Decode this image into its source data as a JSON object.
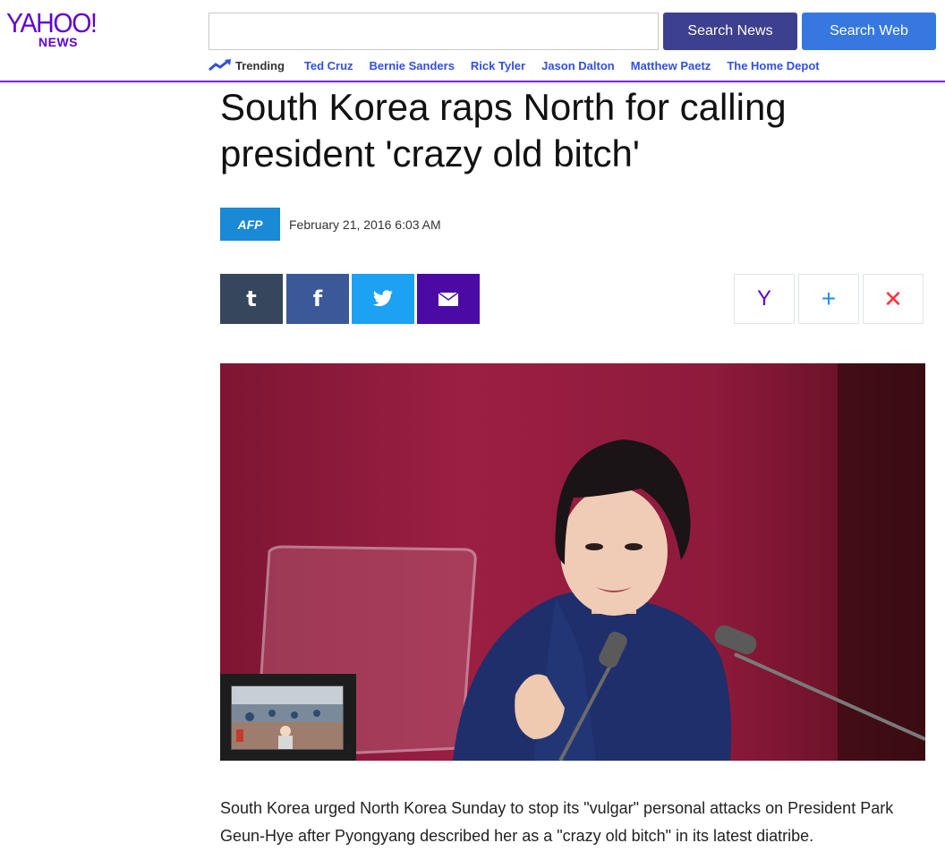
{
  "logo": {
    "main": "YAHOO!",
    "sub": "NEWS"
  },
  "search": {
    "placeholder": "",
    "news_button": "Search News",
    "web_button": "Search Web"
  },
  "trending": {
    "label": "Trending",
    "items": [
      "Ted Cruz",
      "Bernie Sanders",
      "Rick Tyler",
      "Jason Dalton",
      "Matthew Paetz",
      "The Home Depot"
    ]
  },
  "article": {
    "title": "South Korea raps North for calling president 'crazy old bitch'",
    "source_logo": "AFP",
    "date": "February 21, 2016 6:03 AM",
    "body": "South Korea urged North Korea Sunday to stop its \"vulgar\" personal attacks on President Park Geun-Hye after Pyongyang described her as a \"crazy old bitch\" in its latest diatribe."
  },
  "share": {
    "tumblr": "t",
    "facebook": "f",
    "twitter": "twitter-icon",
    "email": "email-icon"
  },
  "actions": {
    "yahoo": "Y",
    "add": "+",
    "close": "✕"
  },
  "colors": {
    "brand": "#5f01d1",
    "search_news": "#3d3f8f",
    "search_web": "#3678e0",
    "trending_link": "#324fe1",
    "afp": "#1a89d6"
  }
}
